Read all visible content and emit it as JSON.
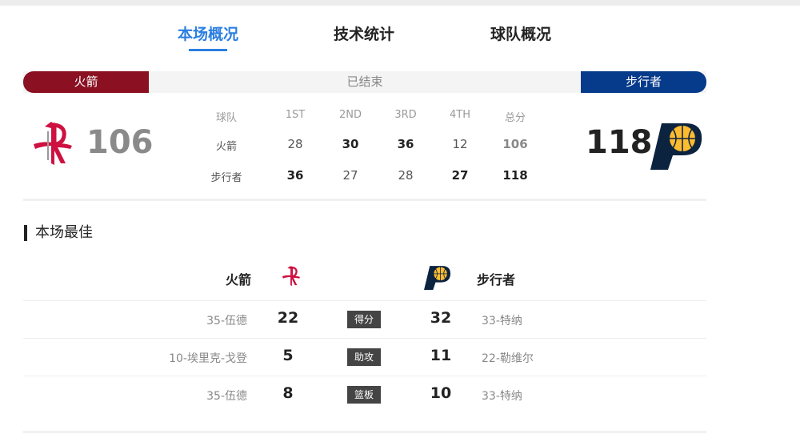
{
  "tabs": [
    {
      "label": "本场概况",
      "active": true
    },
    {
      "label": "技术统计",
      "active": false
    },
    {
      "label": "球队概况",
      "active": false
    }
  ],
  "status": {
    "home_team": "火箭",
    "text": "已结束",
    "away_team": "步行者"
  },
  "colors": {
    "accent": "#2b7fe0",
    "home": "#8a1022",
    "away": "#063a8a",
    "pacers_gold": "#fdbb30"
  },
  "score": {
    "home": "106",
    "away": "118"
  },
  "linescore": {
    "headers": [
      "球队",
      "1ST",
      "2ND",
      "3RD",
      "4TH",
      "总分"
    ],
    "rows": [
      {
        "team": "火箭",
        "values": [
          "28",
          "30",
          "36",
          "12",
          "106"
        ]
      },
      {
        "team": "步行者",
        "values": [
          "36",
          "27",
          "28",
          "27",
          "118"
        ]
      }
    ]
  },
  "best": {
    "title": "本场最佳",
    "home_team": "火箭",
    "away_team": "步行者",
    "rows": [
      {
        "home_player": "35-伍德",
        "home_value": "22",
        "category": "得分",
        "away_value": "32",
        "away_player": "33-特纳"
      },
      {
        "home_player": "10-埃里克-戈登",
        "home_value": "5",
        "category": "助攻",
        "away_value": "11",
        "away_player": "22-勒维尔"
      },
      {
        "home_player": "35-伍德",
        "home_value": "8",
        "category": "篮板",
        "away_value": "10",
        "away_player": "33-特纳"
      }
    ]
  },
  "icons": {
    "home_logo": "rockets-logo-icon",
    "away_logo": "pacers-logo-icon"
  }
}
